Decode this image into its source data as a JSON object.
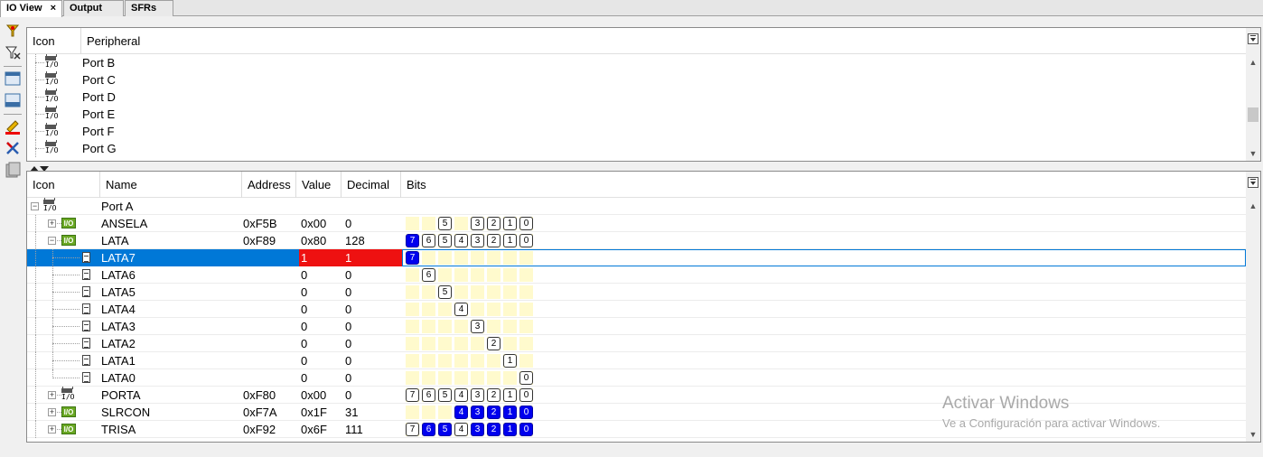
{
  "tabs": [
    {
      "label": "IO View",
      "close": "×",
      "active": true
    },
    {
      "label": "Output",
      "active": false
    },
    {
      "label": "SFRs",
      "active": false
    }
  ],
  "toolbar_icons": [
    "filter-icon",
    "filter-add-icon",
    "window-icon",
    "window-alt-icon",
    "edit-icon",
    "delete-icon",
    "clipboard-icon"
  ],
  "peripheral_panel": {
    "columns": {
      "icon": "Icon",
      "peripheral": "Peripheral"
    },
    "rows": [
      {
        "icon": "io-chip-icon",
        "label": "Port B"
      },
      {
        "icon": "io-chip-icon",
        "label": "Port C"
      },
      {
        "icon": "io-chip-icon",
        "label": "Port D"
      },
      {
        "icon": "io-chip-icon",
        "label": "Port E"
      },
      {
        "icon": "io-chip-icon",
        "label": "Port F"
      },
      {
        "icon": "io-chip-icon",
        "label": "Port G"
      }
    ]
  },
  "register_panel": {
    "columns": {
      "icon": "Icon",
      "name": "Name",
      "address": "Address",
      "value": "Value",
      "decimal": "Decimal",
      "bits": "Bits"
    },
    "rows": [
      {
        "name": "Port A",
        "address": "",
        "value": "",
        "decimal": "",
        "level": 0,
        "type": "port",
        "bits": []
      },
      {
        "name": "ANSELA",
        "address": "0xF5B",
        "value": "0x00",
        "decimal": "0",
        "level": 1,
        "type": "register",
        "bits": [
          {
            "n": "",
            "on": false
          },
          {
            "n": "",
            "on": false
          },
          {
            "n": "5",
            "on": false
          },
          {
            "n": "",
            "on": false
          },
          {
            "n": "3",
            "on": false
          },
          {
            "n": "2",
            "on": false
          },
          {
            "n": "1",
            "on": false
          },
          {
            "n": "0",
            "on": false
          }
        ]
      },
      {
        "name": "LATA",
        "address": "0xF89",
        "value": "0x80",
        "decimal": "128",
        "level": 1,
        "type": "register",
        "expanded": true,
        "bits": [
          {
            "n": "7",
            "on": true
          },
          {
            "n": "6",
            "on": false
          },
          {
            "n": "5",
            "on": false
          },
          {
            "n": "4",
            "on": false
          },
          {
            "n": "3",
            "on": false
          },
          {
            "n": "2",
            "on": false
          },
          {
            "n": "1",
            "on": false
          },
          {
            "n": "0",
            "on": false
          }
        ]
      },
      {
        "name": "LATA7",
        "address": "",
        "value": "1",
        "decimal": "1",
        "level": 2,
        "type": "bit",
        "selected": true,
        "bitpos": 0,
        "on": true
      },
      {
        "name": "LATA6",
        "address": "",
        "value": "0",
        "decimal": "0",
        "level": 2,
        "type": "bit",
        "bitpos": 1,
        "on": false
      },
      {
        "name": "LATA5",
        "address": "",
        "value": "0",
        "decimal": "0",
        "level": 2,
        "type": "bit",
        "bitpos": 2,
        "on": false
      },
      {
        "name": "LATA4",
        "address": "",
        "value": "0",
        "decimal": "0",
        "level": 2,
        "type": "bit",
        "bitpos": 3,
        "on": false
      },
      {
        "name": "LATA3",
        "address": "",
        "value": "0",
        "decimal": "0",
        "level": 2,
        "type": "bit",
        "bitpos": 4,
        "on": false
      },
      {
        "name": "LATA2",
        "address": "",
        "value": "0",
        "decimal": "0",
        "level": 2,
        "type": "bit",
        "bitpos": 5,
        "on": false
      },
      {
        "name": "LATA1",
        "address": "",
        "value": "0",
        "decimal": "0",
        "level": 2,
        "type": "bit",
        "bitpos": 6,
        "on": false
      },
      {
        "name": "LATA0",
        "address": "",
        "value": "0",
        "decimal": "0",
        "level": 2,
        "type": "bit",
        "bitpos": 7,
        "on": false
      },
      {
        "name": "PORTA",
        "address": "0xF80",
        "value": "0x00",
        "decimal": "0",
        "level": 1,
        "type": "register-chip",
        "bits": [
          {
            "n": "7",
            "on": false
          },
          {
            "n": "6",
            "on": false
          },
          {
            "n": "5",
            "on": false
          },
          {
            "n": "4",
            "on": false
          },
          {
            "n": "3",
            "on": false
          },
          {
            "n": "2",
            "on": false
          },
          {
            "n": "1",
            "on": false
          },
          {
            "n": "0",
            "on": false
          }
        ]
      },
      {
        "name": "SLRCON",
        "address": "0xF7A",
        "value": "0x1F",
        "decimal": "31",
        "level": 1,
        "type": "register",
        "bits": [
          {
            "n": "",
            "on": false
          },
          {
            "n": "",
            "on": false
          },
          {
            "n": "",
            "on": false
          },
          {
            "n": "4",
            "on": true
          },
          {
            "n": "3",
            "on": true
          },
          {
            "n": "2",
            "on": true
          },
          {
            "n": "1",
            "on": true
          },
          {
            "n": "0",
            "on": true
          }
        ]
      },
      {
        "name": "TRISA",
        "address": "0xF92",
        "value": "0x6F",
        "decimal": "111",
        "level": 1,
        "type": "register",
        "bits": [
          {
            "n": "7",
            "on": false
          },
          {
            "n": "6",
            "on": true
          },
          {
            "n": "5",
            "on": true
          },
          {
            "n": "4",
            "on": false
          },
          {
            "n": "3",
            "on": true
          },
          {
            "n": "2",
            "on": true
          },
          {
            "n": "1",
            "on": true
          },
          {
            "n": "0",
            "on": true
          }
        ]
      }
    ]
  },
  "io_label": "I/O",
  "expand_plus": "+",
  "expand_minus": "−",
  "watermark": {
    "title": "Activar Windows",
    "subtitle": "Ve a Configuración para activar Windows."
  },
  "colors": {
    "selection": "#0078d7",
    "value_highlight": "#ee1111",
    "bit_on": "#0000ee",
    "bit_bg": "#fffacd"
  }
}
